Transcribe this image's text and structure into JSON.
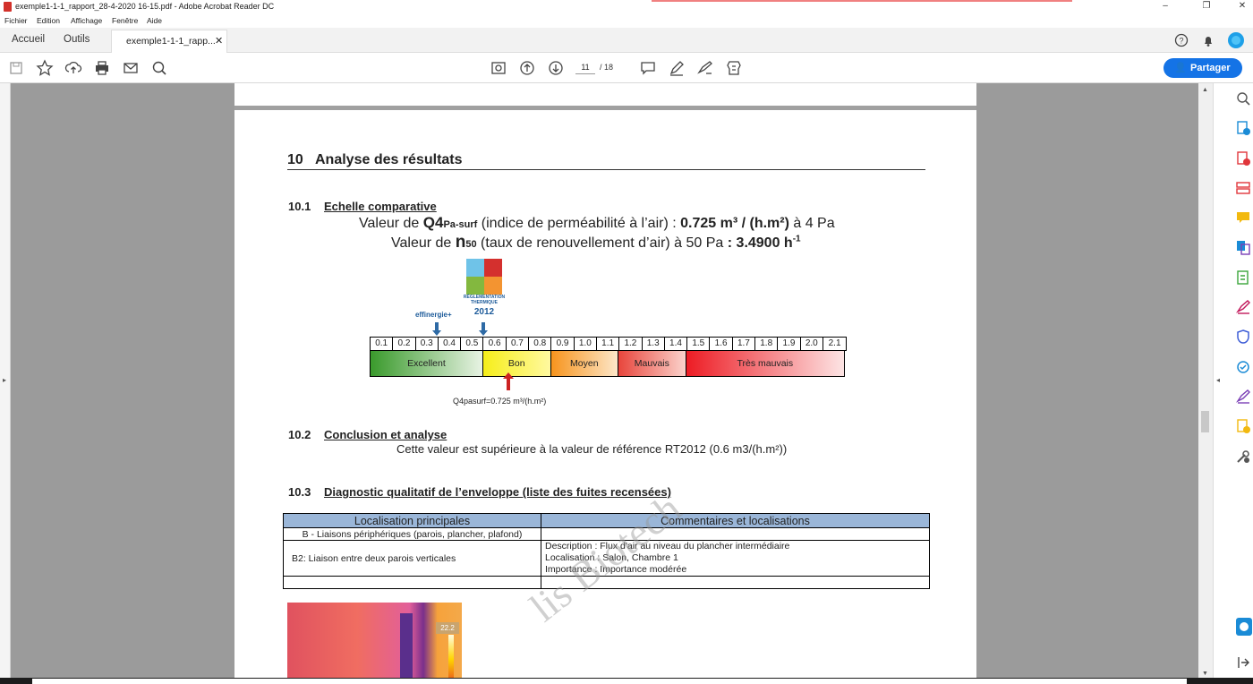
{
  "window": {
    "title": "exemple1-1-1_rapport_28-4-2020 16-15.pdf - Adobe Acrobat Reader DC",
    "min": "–",
    "restore": "❐",
    "close": "✕"
  },
  "menu": [
    "Fichier",
    "Edition",
    "Affichage",
    "Fenêtre",
    "Aide"
  ],
  "tabs": {
    "home": "Accueil",
    "tools": "Outils",
    "doc": "exemple1-1-1_rapp...",
    "close": "✕"
  },
  "toolbar": {
    "page_current": "11",
    "page_total": "/ 18",
    "share": "Partager"
  },
  "document": {
    "section10": {
      "num": "10",
      "title": "Analyse des résultats"
    },
    "s101": {
      "num": "10.1",
      "title": "Echelle comparative"
    },
    "line1": {
      "a": "Valeur de ",
      "q": "Q4",
      "sub": "Pa-surf",
      "b": " (indice de perméabilité à l’air) : ",
      "val": "0.725 m³ / (h.m²)",
      "c": " à 4 Pa"
    },
    "line2": {
      "a": "Valeur de ",
      "n": "n",
      "sub": "50",
      "b": " (taux de renouvellement d’air) à 50 Pa ",
      "val": ": 3.4900 h",
      "sup": "-1"
    },
    "logo": {
      "caption": "RÉGLEMENTATION THERMIQUE",
      "year": "2012",
      "effi": "effinergie+"
    },
    "scale_ticks": [
      "0.1",
      "0.2",
      "0.3",
      "0.4",
      "0.5",
      "0.6",
      "0.7",
      "0.8",
      "0.9",
      "1.0",
      "1.1",
      "1.2",
      "1.3",
      "1.4",
      "1.5",
      "1.6",
      "1.7",
      "1.8",
      "1.9",
      "2.0",
      "2.1"
    ],
    "bands": [
      {
        "label": "Excellent",
        "span": 5,
        "from": "#3a9a2c",
        "to": "#e8f3e4"
      },
      {
        "label": "Bon",
        "span": 3,
        "from": "#f6ee1a",
        "to": "#fff9a0"
      },
      {
        "label": "Moyen",
        "span": 3,
        "from": "#f7941d",
        "to": "#fde7c9"
      },
      {
        "label": "Mauvais",
        "span": 3,
        "from": "#e8453c",
        "to": "#fbd3cc"
      },
      {
        "label": "Très mauvais",
        "span": 7,
        "from": "#ed1c24",
        "to": "#fde4e4"
      }
    ],
    "q4_label": "Q4pasurf=0.725 m³/(h.m²)",
    "s102": {
      "num": "10.2",
      "title": "Conclusion et analyse",
      "text": "Cette valeur est supérieure à la valeur de référence RT2012 (0.6 m3/(h.m²))"
    },
    "s103": {
      "num": "10.3",
      "title": "Diagnostic qualitatif de l’enveloppe (liste des fuites recensées)"
    },
    "table": {
      "headers": [
        "Localisation principales",
        "Commentaires et localisations"
      ],
      "row1": "B - Liaisons périphériques (parois, plancher, plafond)",
      "row2_left": "B2: Liaison entre deux parois verticales",
      "row2_right": [
        "Description : Flux d'air au niveau du plancher intermédiaire",
        "Localisation : Salon, Chambre 1",
        "Importance : Importance modérée"
      ]
    },
    "thermal_tag": "22.2",
    "watermark": "lis Biotech"
  },
  "colors": {
    "accent": "#1473e6",
    "table_header": "#9ab6d8"
  }
}
